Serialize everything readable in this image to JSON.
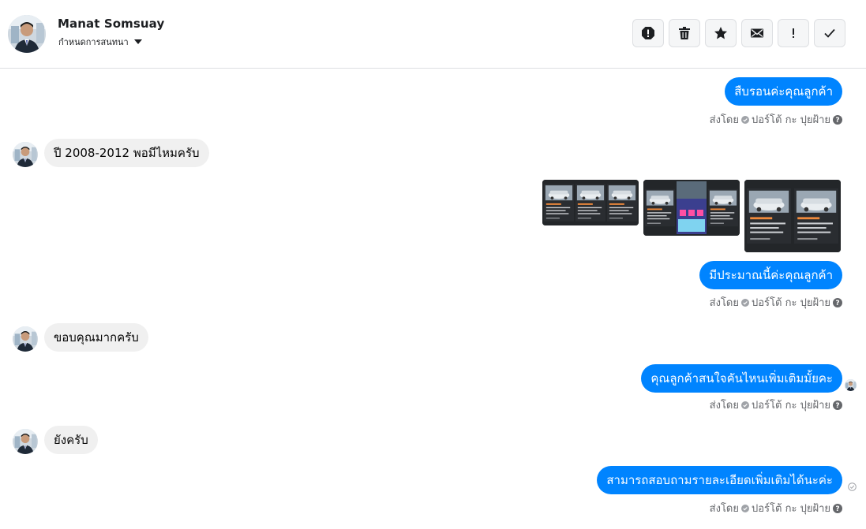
{
  "header": {
    "name": "Manat Somsuay",
    "assign_label": "กำหนดการสนทนา",
    "toolbar": [
      "spam-icon",
      "trash-icon",
      "star-icon",
      "envelope-icon",
      "exclamation-icon",
      "check-icon"
    ]
  },
  "meta": {
    "sent_by": "ส่งโดย",
    "agent": "ปอร์โต้ กะ ปุยฝ้าย"
  },
  "messages": {
    "m1": "สืบรอนค่ะคุณลูกค้า",
    "m2": "ปี 2008-2012 พอมีไหมครับ",
    "m3": "มีประมาณนี้ค่ะคุณลูกค้า",
    "m4": "ขอบคุณมากครับ",
    "m5": "คุณลูกค้าสนใจคันไหนเพิ่มเติมมั้ยคะ",
    "m6": "ยังครับ",
    "m7": "สามารถสอบถามรายละเอียดเพิ่มเติมได้นะค่ะ"
  },
  "colors": {
    "outgoing_bubble": "#0084ff",
    "incoming_bubble": "#f0f0f0"
  }
}
